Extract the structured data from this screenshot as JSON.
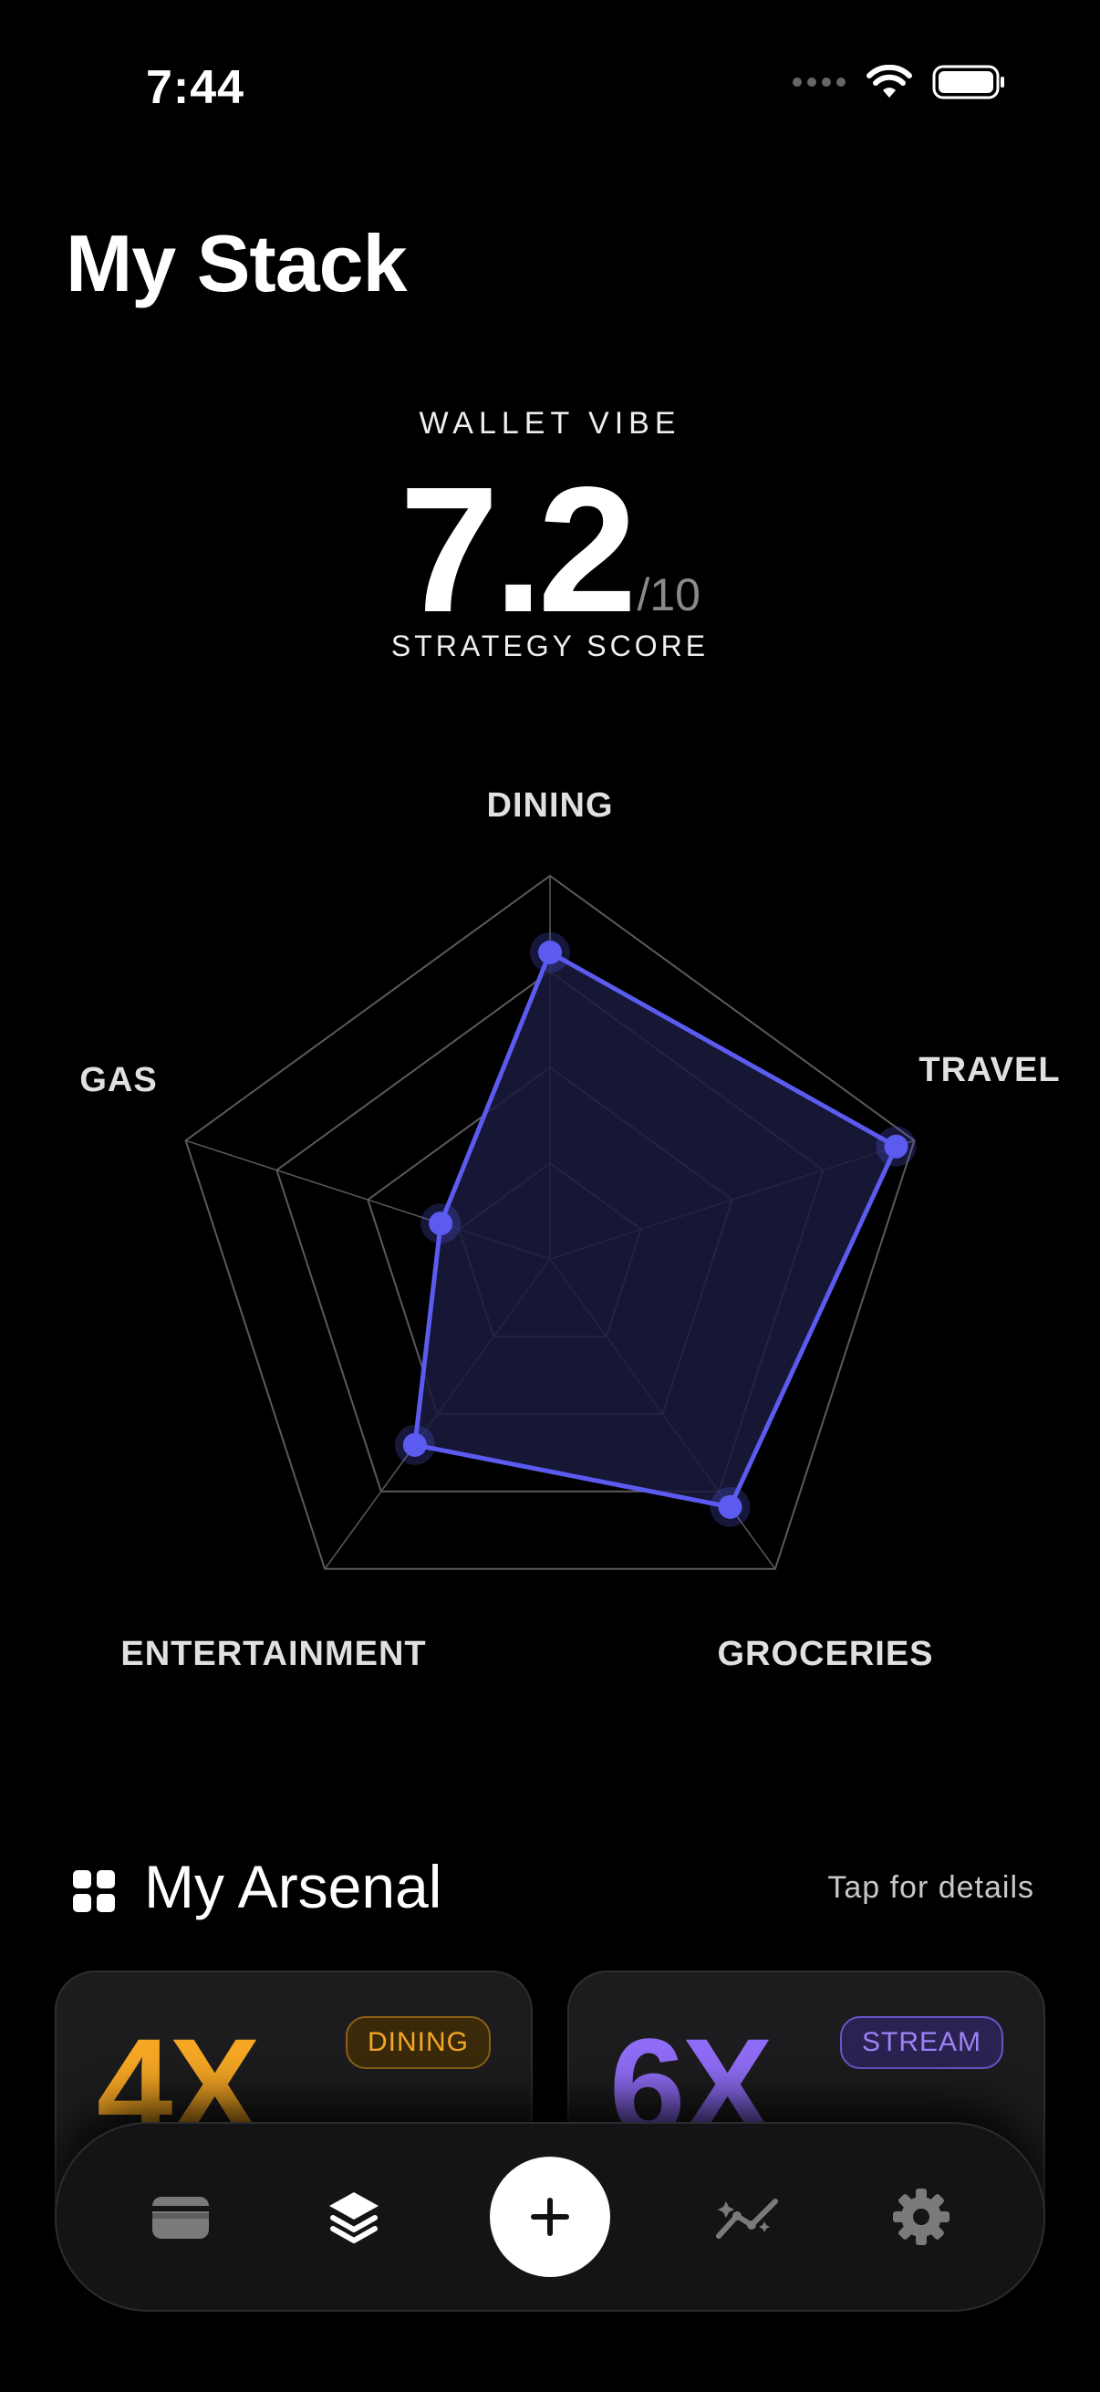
{
  "status_bar": {
    "time": "7:44"
  },
  "page": {
    "title": "My Stack"
  },
  "score": {
    "label": "WALLET VIBE",
    "value": "7.2",
    "max": "/10",
    "caption": "STRATEGY SCORE"
  },
  "chart_data": {
    "type": "radar",
    "axes": [
      "DINING",
      "TRAVEL",
      "GROCERIES",
      "ENTERTAINMENT",
      "GAS"
    ],
    "values": [
      0.8,
      0.95,
      0.8,
      0.6,
      0.3
    ],
    "range": [
      0,
      1
    ],
    "rings": 4,
    "colors": {
      "series": "#5b5bf0",
      "fill": "#1a1a3e",
      "grid": "#5a5a5a"
    }
  },
  "arsenal": {
    "title": "My Arsenal",
    "hint": "Tap for details",
    "icon": "grid-icon",
    "cards": [
      {
        "multiplier": "4X",
        "badge": "DINING",
        "color": "#f5a623"
      },
      {
        "multiplier": "6X",
        "badge": "STREAM",
        "color": "#8e6cf5"
      }
    ]
  },
  "nav": {
    "items": [
      "wallet-icon",
      "layers-icon",
      "plus-icon",
      "trend-icon",
      "gear-icon"
    ],
    "active": "layers-icon"
  }
}
